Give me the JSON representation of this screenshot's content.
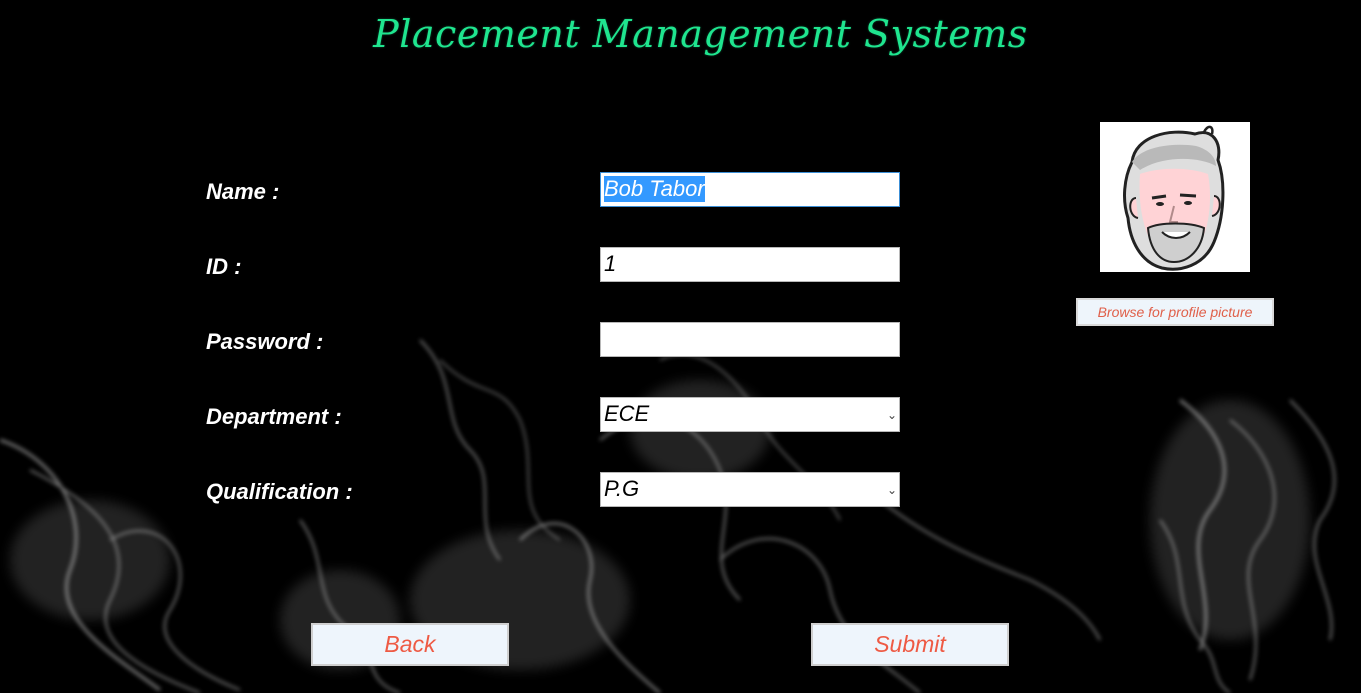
{
  "title": "Placement Management Systems",
  "form": {
    "name_label": "Name :",
    "name_value": "Bob Tabor",
    "id_label": "ID :",
    "id_value": "1",
    "password_label": "Password :",
    "password_value": "",
    "department_label": "Department :",
    "department_value": "ECE",
    "qualification_label": "Qualification :",
    "qualification_value": "P.G"
  },
  "profile": {
    "browse_label": "Browse for profile picture"
  },
  "buttons": {
    "back_label": "Back",
    "submit_label": "Submit"
  },
  "colors": {
    "title": "#1fe58f",
    "button_text": "#ee5a44",
    "selection": "#3399ff"
  }
}
